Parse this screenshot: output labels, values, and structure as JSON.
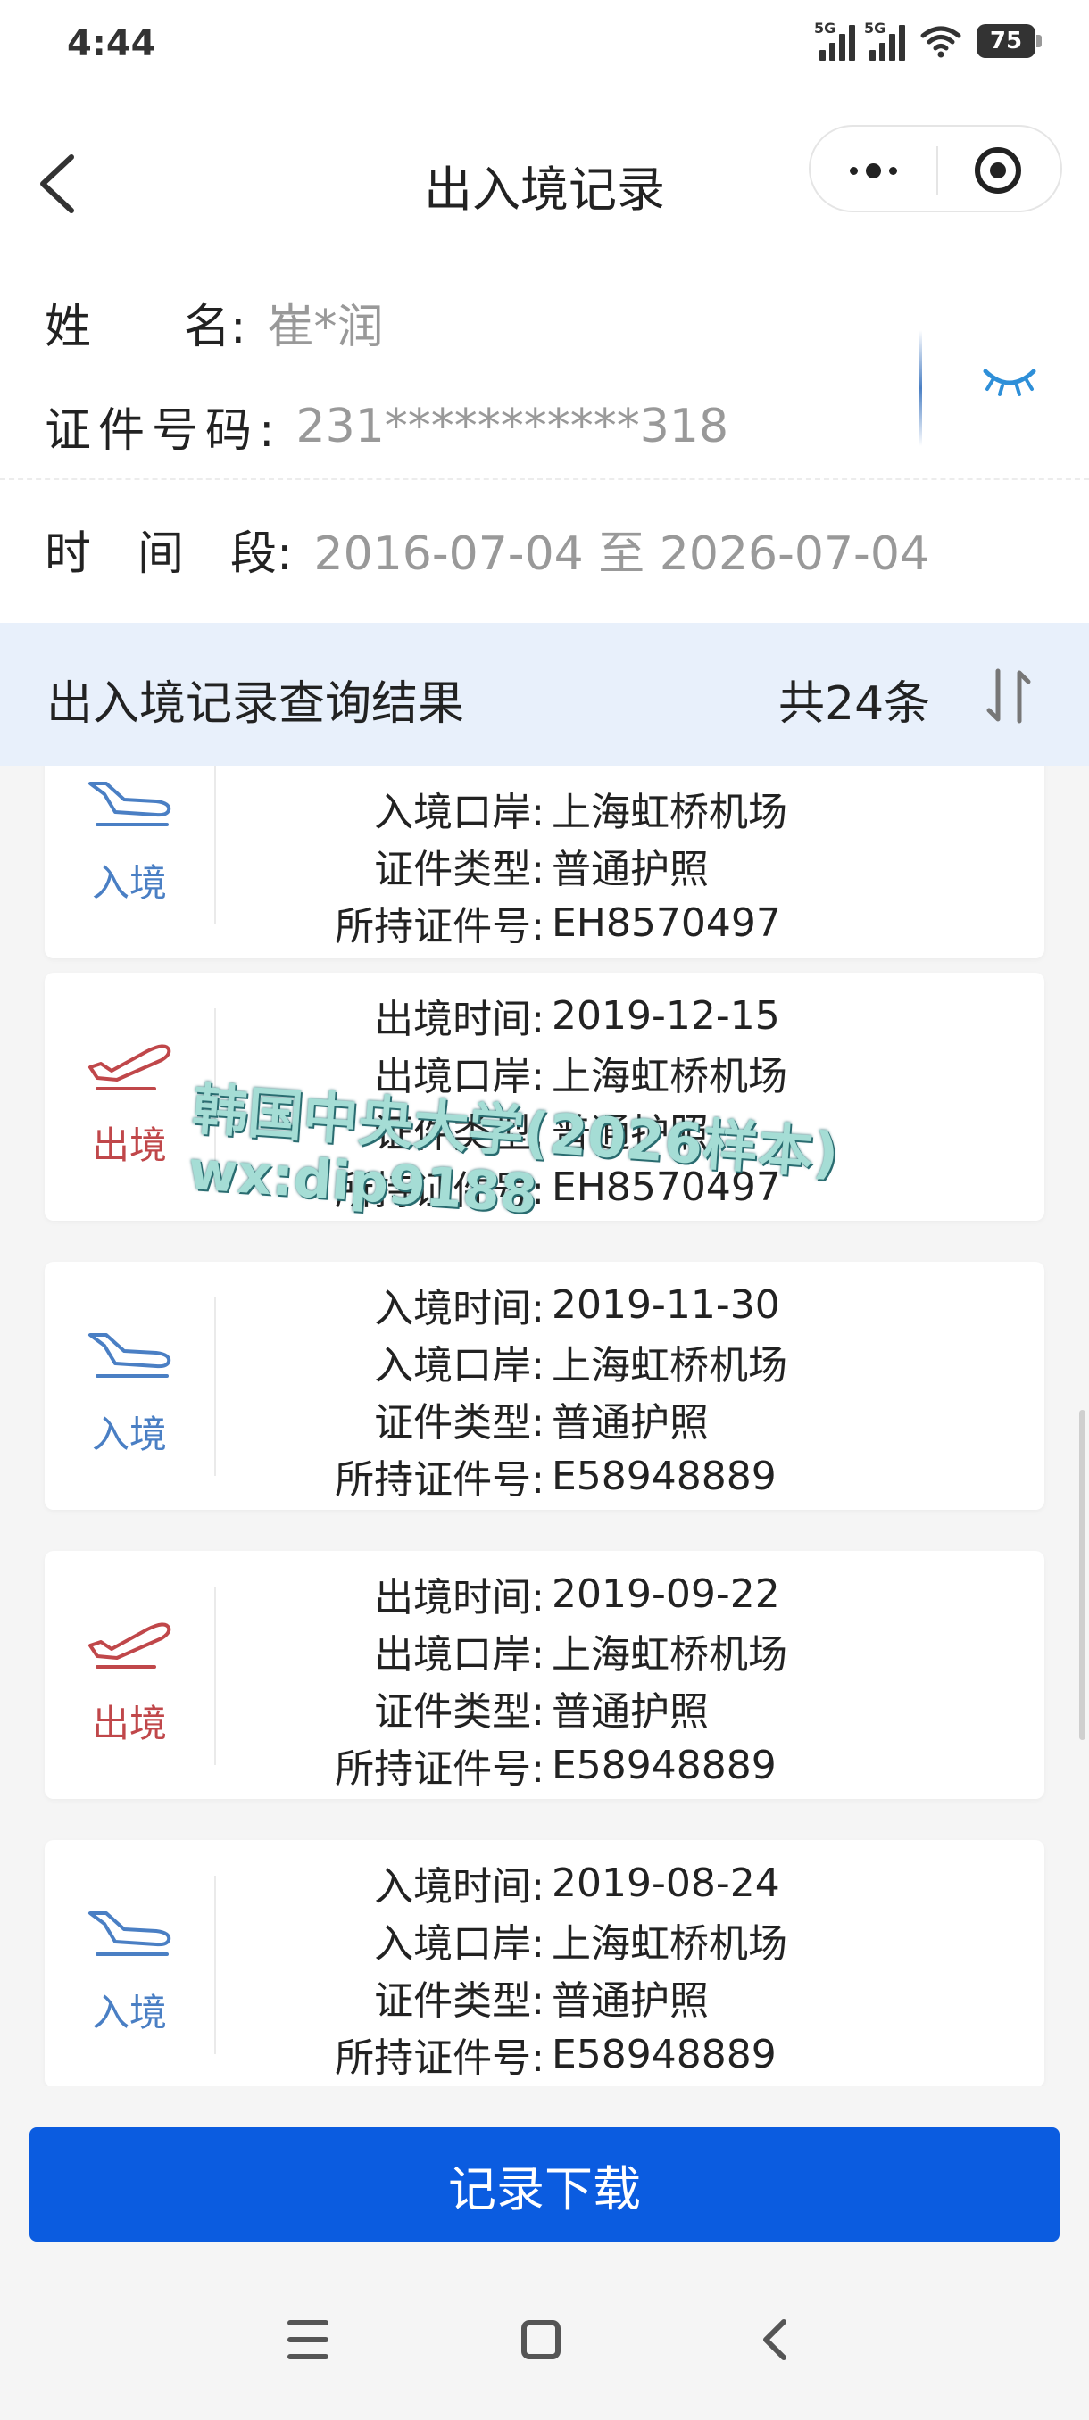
{
  "status_bar": {
    "time": "4:44",
    "signal1": "5G",
    "signal2": "5G",
    "battery": "75"
  },
  "header": {
    "title": "出入境记录"
  },
  "info": {
    "name_label": "姓　　名:",
    "name_value": "崔*润",
    "id_label": "证件号码:",
    "id_value": "231***********318",
    "period_label": "时　间　段:",
    "period_value": "2016-07-04 至 2026-07-04"
  },
  "results": {
    "title": "出入境记录查询结果",
    "count": "共24条"
  },
  "records": [
    {
      "type": "in",
      "direction": "入境",
      "rows": [
        {
          "k": "入境口岸:",
          "v": "上海虹桥机场"
        },
        {
          "k": "证件类型:",
          "v": "普通护照"
        },
        {
          "k": "所持证件号:",
          "v": "EH8570497"
        }
      ]
    },
    {
      "type": "out",
      "direction": "出境",
      "rows": [
        {
          "k": "出境时间:",
          "v": "2019-12-15"
        },
        {
          "k": "出境口岸:",
          "v": "上海虹桥机场"
        },
        {
          "k": "证件类型:",
          "v": "普通护照"
        },
        {
          "k": "所持证件号:",
          "v": "EH8570497"
        }
      ]
    },
    {
      "type": "in",
      "direction": "入境",
      "rows": [
        {
          "k": "入境时间:",
          "v": "2019-11-30"
        },
        {
          "k": "入境口岸:",
          "v": "上海虹桥机场"
        },
        {
          "k": "证件类型:",
          "v": "普通护照"
        },
        {
          "k": "所持证件号:",
          "v": "E58948889"
        }
      ]
    },
    {
      "type": "out",
      "direction": "出境",
      "rows": [
        {
          "k": "出境时间:",
          "v": "2019-09-22"
        },
        {
          "k": "出境口岸:",
          "v": "上海虹桥机场"
        },
        {
          "k": "证件类型:",
          "v": "普通护照"
        },
        {
          "k": "所持证件号:",
          "v": "E58948889"
        }
      ]
    },
    {
      "type": "in",
      "direction": "入境",
      "rows": [
        {
          "k": "入境时间:",
          "v": "2019-08-24"
        },
        {
          "k": "入境口岸:",
          "v": "上海虹桥机场"
        },
        {
          "k": "证件类型:",
          "v": "普通护照"
        },
        {
          "k": "所持证件号:",
          "v": "E58948889"
        }
      ]
    }
  ],
  "watermark": {
    "line1": "韩国中央大学(2026样本)",
    "line2": "wx:dip9188"
  },
  "download_button": "记录下载",
  "colors": {
    "accent": "#0b5ce0",
    "entry": "#4a7fc4",
    "exit": "#c0474a",
    "result_bg": "#e8f0fb"
  },
  "icons": [
    "back-arrow-icon",
    "more-dots-icon",
    "close-target-icon",
    "eye-closed-icon",
    "sort-icon",
    "plane-landing-icon",
    "plane-departure-icon",
    "menu-icon",
    "home-icon",
    "back-icon"
  ]
}
